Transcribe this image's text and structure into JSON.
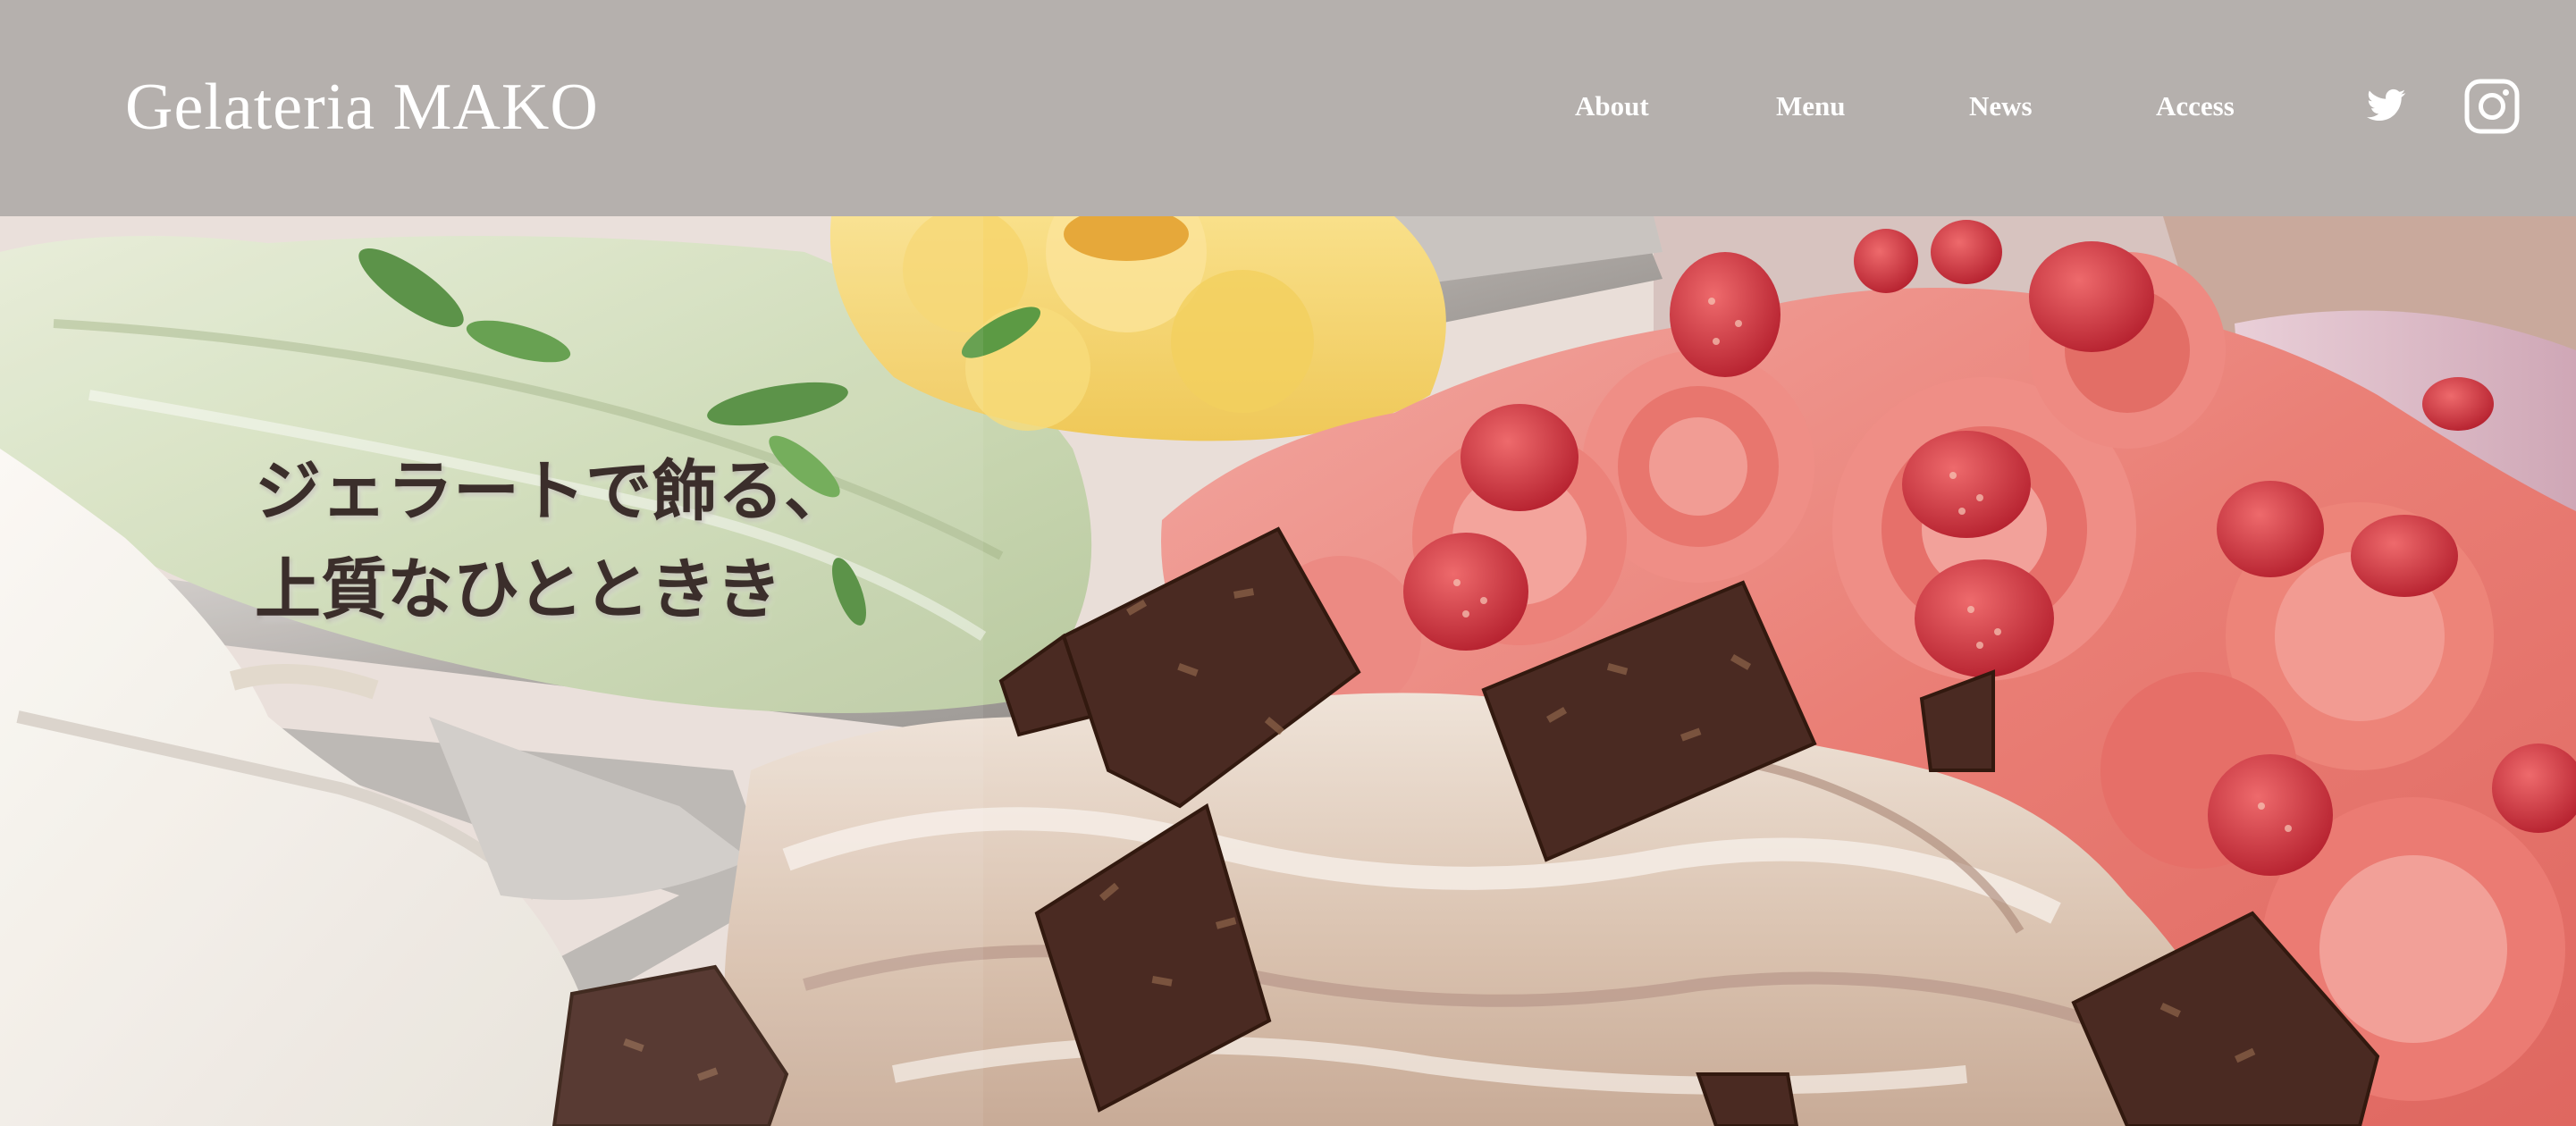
{
  "header": {
    "logo": "Gelateria MAKO",
    "nav": {
      "about": "About",
      "menu": "Menu",
      "news": "News",
      "access": "Access"
    },
    "social": [
      "twitter-icon",
      "instagram-icon"
    ],
    "background_color": "#b5b0ad"
  },
  "hero": {
    "tagline_line1": "ジェラートで飾る、",
    "tagline_line2": "上質なひとときき",
    "image": "gelato-display-photo",
    "tagline_color": "#3b2e2b"
  }
}
